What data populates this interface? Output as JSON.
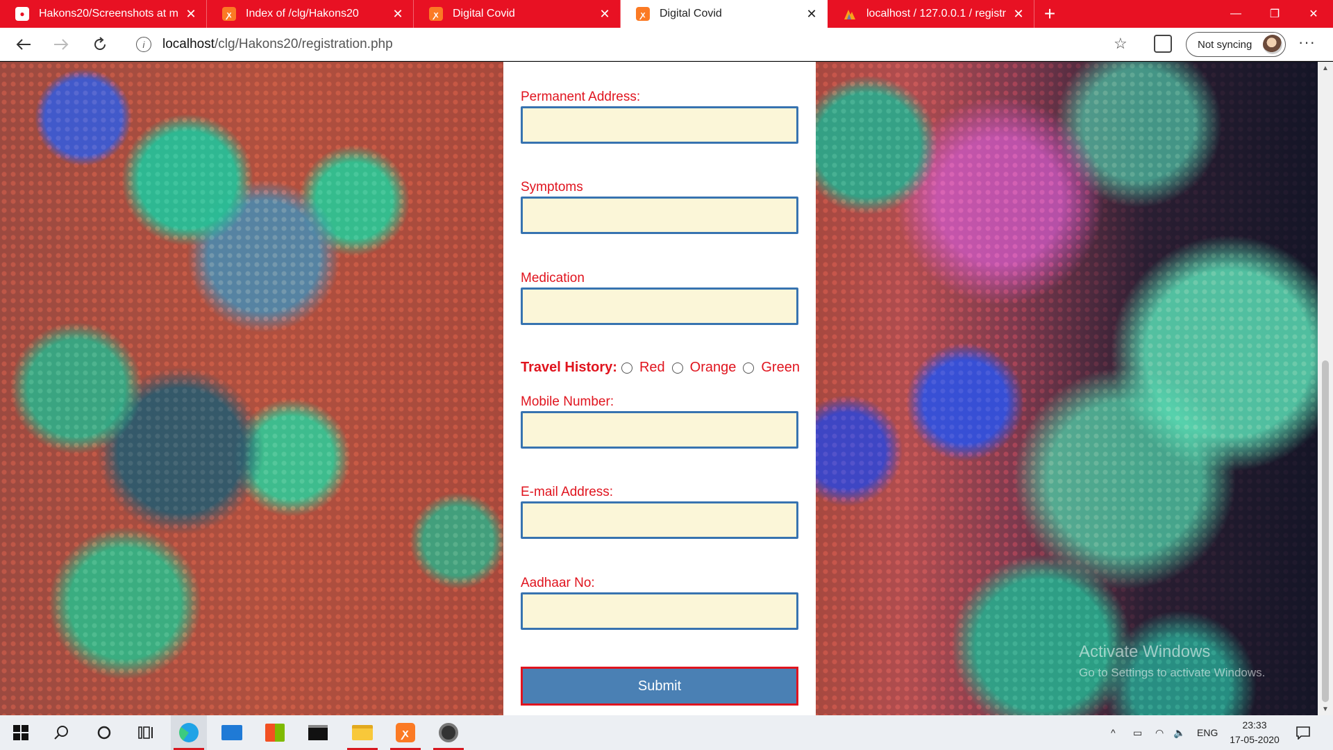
{
  "browser": {
    "tabs": [
      {
        "title": "Hakons20/Screenshots at master",
        "favicon": "github-icon",
        "active": false
      },
      {
        "title": "Index of /clg/Hakons20",
        "favicon": "xampp-icon",
        "active": false
      },
      {
        "title": "Digital Covid",
        "favicon": "xampp-icon",
        "active": false
      },
      {
        "title": "Digital Covid",
        "favicon": "xampp-icon",
        "active": true
      },
      {
        "title": "localhost / 127.0.0.1 / registration",
        "favicon": "phpmyadmin-icon",
        "active": false
      }
    ],
    "address": {
      "host": "localhost",
      "path": "/clg/Hakons20/registration.php"
    },
    "sync_label": "Not syncing",
    "accent_color": "#e81123"
  },
  "form": {
    "permanent_address_label": "Permanent Address:",
    "symptoms_label": "Symptoms",
    "medication_label": "Medication",
    "travel_history_label": "Travel History:",
    "travel_options": [
      "Red",
      "Orange",
      "Green"
    ],
    "mobile_label": "Mobile Number:",
    "email_label": "E-mail Address:",
    "aadhaar_label": "Aadhaar No:",
    "submit_label": "Submit",
    "label_color": "#e0141e",
    "input_bg": "#fbf6d8",
    "button_color": "#4a80b4"
  },
  "watermark": {
    "line1": "Activate Windows",
    "line2": "Go to Settings to activate Windows."
  },
  "taskbar": {
    "language": "ENG",
    "time": "23:33",
    "date": "17-05-2020"
  }
}
